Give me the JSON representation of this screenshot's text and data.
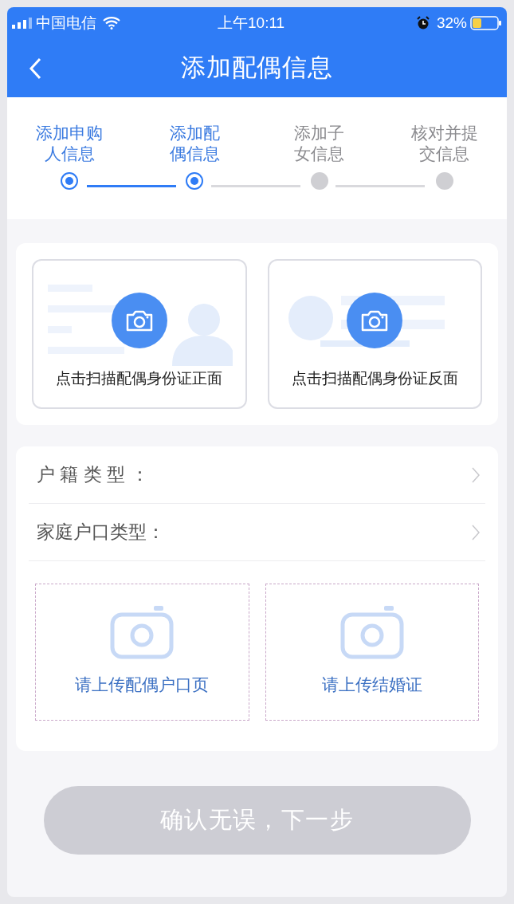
{
  "status_bar": {
    "carrier": "中国电信",
    "time": "上午10:11",
    "battery": "32%"
  },
  "nav": {
    "title": "添加配偶信息"
  },
  "steps": [
    {
      "line1": "添加申购",
      "line2": "人信息",
      "done": true
    },
    {
      "line1": "添加配",
      "line2": "偶信息",
      "done": true
    },
    {
      "line1": "添加子",
      "line2": "女信息",
      "done": false
    },
    {
      "line1": "核对并提",
      "line2": "交信息",
      "done": false
    }
  ],
  "scan_cards": [
    {
      "kind": "front",
      "label": "点击扫描配偶身份证正面"
    },
    {
      "kind": "back",
      "label": "点击扫描配偶身份证反面"
    }
  ],
  "fields": [
    {
      "label": "户 籍 类 型 ："
    },
    {
      "label": "家庭户口类型："
    }
  ],
  "uploads": [
    {
      "label": "请上传配偶户口页"
    },
    {
      "label": "请上传结婚证"
    }
  ],
  "next_button": {
    "label": "确认无误，下一步",
    "disabled": true
  }
}
